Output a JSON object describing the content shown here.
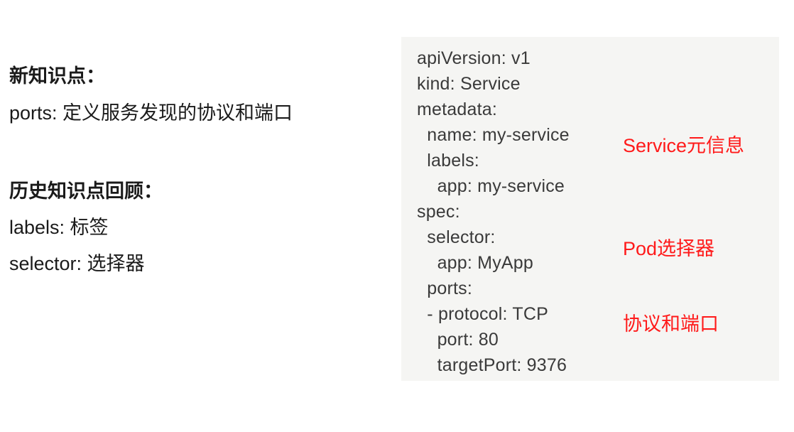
{
  "new_knowledge": {
    "heading": "新知识点：",
    "items": [
      "ports: 定义服务发现的协议和端口"
    ]
  },
  "history_review": {
    "heading": "历史知识点回顾：",
    "items": [
      "labels: 标签",
      "selector: 选择器"
    ]
  },
  "yaml_example": {
    "lines": [
      "apiVersion: v1",
      "kind: Service",
      "metadata:",
      "  name: my-service",
      "  labels:",
      "    app: my-service",
      "spec:",
      "  selector:",
      "    app: MyApp",
      "  ports:",
      "  - protocol: TCP",
      "    port: 80",
      "    targetPort: 9376"
    ],
    "annotations": [
      "Service元信息",
      "Pod选择器",
      "协议和端口"
    ]
  },
  "colors": {
    "annotation": "#ff1a1a",
    "code_background": "#f5f5f3",
    "code_text": "#3a3a3a"
  }
}
